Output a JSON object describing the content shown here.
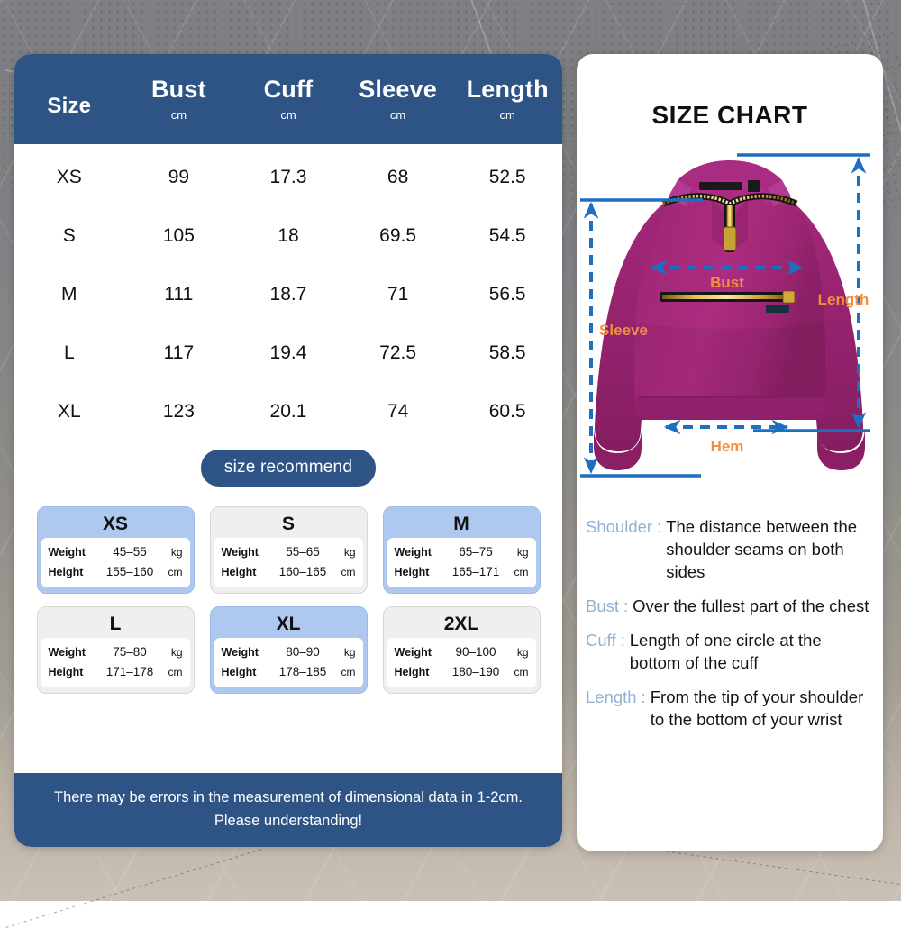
{
  "theme": {
    "header_blue": "#2e5485",
    "card_highlight_blue": "#aec8ef",
    "card_plain_gray": "#efefef",
    "garment_magenta": "#a32879",
    "arrow_blue": "#1f6fc0",
    "measure_label_orange": "#f0903c",
    "term_blue": "#8fb2d4"
  },
  "table": {
    "columns": [
      {
        "title": "Size",
        "unit": ""
      },
      {
        "title": "Bust",
        "unit": "cm"
      },
      {
        "title": "Cuff",
        "unit": "cm"
      },
      {
        "title": "Sleeve",
        "unit": "cm"
      },
      {
        "title": "Length",
        "unit": "cm"
      }
    ],
    "rows": [
      {
        "size": "XS",
        "bust": "99",
        "cuff": "17.3",
        "sleeve": "68",
        "length": "52.5"
      },
      {
        "size": "S",
        "bust": "105",
        "cuff": "18",
        "sleeve": "69.5",
        "length": "54.5"
      },
      {
        "size": "M",
        "bust": "111",
        "cuff": "18.7",
        "sleeve": "71",
        "length": "56.5"
      },
      {
        "size": "L",
        "bust": "117",
        "cuff": "19.4",
        "sleeve": "72.5",
        "length": "58.5"
      },
      {
        "size": "XL",
        "bust": "123",
        "cuff": "20.1",
        "sleeve": "74",
        "length": "60.5"
      }
    ]
  },
  "recommend": {
    "pill_label": "size recommend",
    "row_labels": {
      "weight": "Weight",
      "height": "Height"
    },
    "units": {
      "weight": "kg",
      "height": "cm"
    },
    "cards": [
      {
        "size": "XS",
        "weight": "45–55",
        "height": "155–160",
        "highlighted": true
      },
      {
        "size": "S",
        "weight": "55–65",
        "height": "160–165",
        "highlighted": false
      },
      {
        "size": "M",
        "weight": "65–75",
        "height": "165–171",
        "highlighted": true
      },
      {
        "size": "L",
        "weight": "75–80",
        "height": "171–178",
        "highlighted": false
      },
      {
        "size": "XL",
        "weight": "80–90",
        "height": "178–185",
        "highlighted": true
      },
      {
        "size": "2XL",
        "weight": "90–100",
        "height": "180–190",
        "highlighted": false
      }
    ]
  },
  "footer_note": "There may be errors in the measurement of dimensional data in 1-2cm. Please understanding!",
  "right": {
    "title": "SIZE CHART",
    "diagram_labels": {
      "bust": "Bust",
      "sleeve": "Sleeve",
      "length": "Length",
      "hem": "Hem"
    },
    "definitions": [
      {
        "term": "Shoulder",
        "sep": ":",
        "desc": "The distance between the shoulder seams on both sides"
      },
      {
        "term": "Bust",
        "sep": ":",
        "desc": "Over the fullest part of the chest"
      },
      {
        "term": "Cuff",
        "sep": ":",
        "desc": "Length of one circle at the bottom of the cuff"
      },
      {
        "term": "Length",
        "sep": ":",
        "desc": "From the tip of your shoulder to the bottom of your wrist"
      }
    ]
  }
}
